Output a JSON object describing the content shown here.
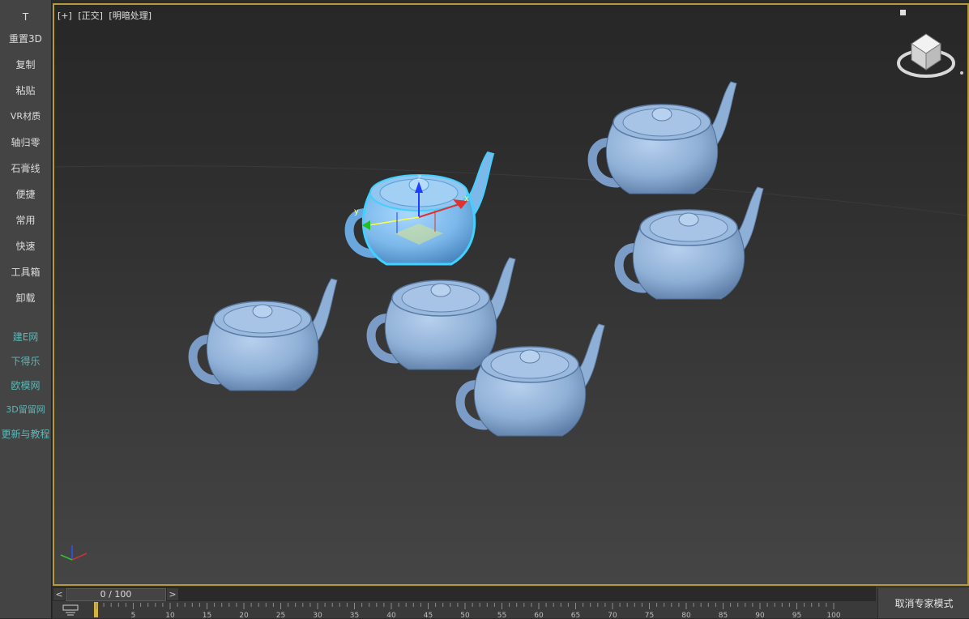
{
  "sidebar": {
    "items": [
      {
        "label": "T"
      },
      {
        "label": "重置3D"
      },
      {
        "label": "复制"
      },
      {
        "label": "粘贴"
      },
      {
        "label": "VR材质"
      },
      {
        "label": "轴归零"
      },
      {
        "label": "石膏线"
      },
      {
        "label": "便捷"
      },
      {
        "label": "常用"
      },
      {
        "label": "快速"
      },
      {
        "label": "工具箱"
      },
      {
        "label": "卸载"
      }
    ],
    "links": [
      {
        "label": "建E网"
      },
      {
        "label": "下得乐"
      },
      {
        "label": "欧模网"
      },
      {
        "label": "3D留留网"
      },
      {
        "label": "更新与教程"
      }
    ]
  },
  "viewport": {
    "label_plus": "[+]",
    "label_view": "[正交]",
    "label_shading": "[明暗处理]",
    "gizmo_labels": {
      "z": "z",
      "x": "x",
      "y": "y"
    },
    "colors": {
      "teapot": "#8fb0d6",
      "selection": "#41d0ff",
      "border": "#b49a3c"
    }
  },
  "timeline": {
    "prev_label": "<",
    "next_label": ">",
    "frame_readout": "0 / 100",
    "ticks": [
      "5",
      "10",
      "15",
      "20",
      "25",
      "30",
      "35",
      "40",
      "45",
      "50",
      "55",
      "60",
      "65",
      "70",
      "75",
      "80",
      "85",
      "90",
      "95",
      "100"
    ],
    "expert_mode_label": "取消专家模式"
  }
}
